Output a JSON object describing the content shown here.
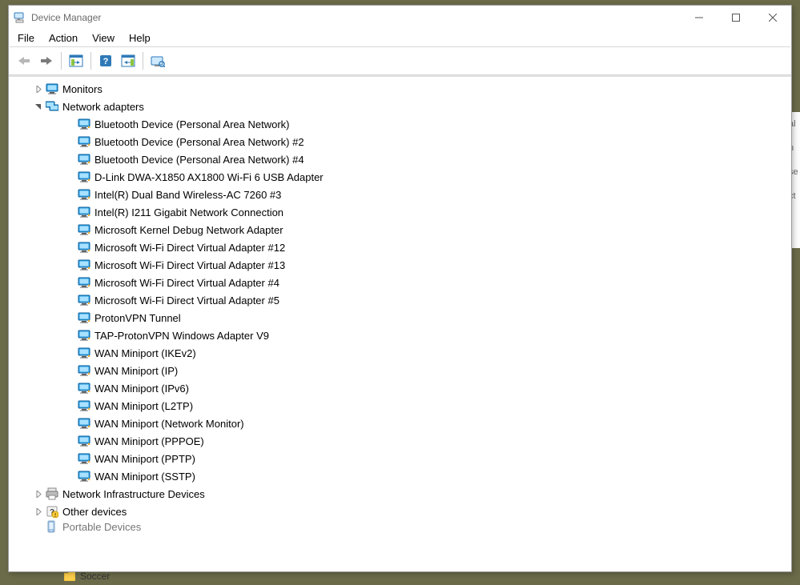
{
  "window": {
    "title": "Device Manager"
  },
  "menu": {
    "file": "File",
    "action": "Action",
    "view": "View",
    "help": "Help"
  },
  "tree": [
    {
      "level": 1,
      "expand": "collapsed",
      "icon": "monitor",
      "label": "Monitors"
    },
    {
      "level": 1,
      "expand": "expanded",
      "icon": "netcat",
      "label": "Network adapters"
    },
    {
      "level": 2,
      "expand": "none",
      "icon": "net",
      "label": "Bluetooth Device (Personal Area Network)"
    },
    {
      "level": 2,
      "expand": "none",
      "icon": "net",
      "label": "Bluetooth Device (Personal Area Network) #2"
    },
    {
      "level": 2,
      "expand": "none",
      "icon": "net",
      "label": "Bluetooth Device (Personal Area Network) #4"
    },
    {
      "level": 2,
      "expand": "none",
      "icon": "net",
      "label": "D-Link DWA-X1850 AX1800 Wi-Fi 6 USB Adapter"
    },
    {
      "level": 2,
      "expand": "none",
      "icon": "net",
      "label": "Intel(R) Dual Band Wireless-AC 7260 #3"
    },
    {
      "level": 2,
      "expand": "none",
      "icon": "net",
      "label": "Intel(R) I211 Gigabit Network Connection"
    },
    {
      "level": 2,
      "expand": "none",
      "icon": "net",
      "label": "Microsoft Kernel Debug Network Adapter"
    },
    {
      "level": 2,
      "expand": "none",
      "icon": "net",
      "label": "Microsoft Wi-Fi Direct Virtual Adapter #12"
    },
    {
      "level": 2,
      "expand": "none",
      "icon": "net",
      "label": "Microsoft Wi-Fi Direct Virtual Adapter #13"
    },
    {
      "level": 2,
      "expand": "none",
      "icon": "net",
      "label": "Microsoft Wi-Fi Direct Virtual Adapter #4"
    },
    {
      "level": 2,
      "expand": "none",
      "icon": "net",
      "label": "Microsoft Wi-Fi Direct Virtual Adapter #5"
    },
    {
      "level": 2,
      "expand": "none",
      "icon": "net",
      "label": "ProtonVPN Tunnel"
    },
    {
      "level": 2,
      "expand": "none",
      "icon": "net",
      "label": "TAP-ProtonVPN Windows Adapter V9"
    },
    {
      "level": 2,
      "expand": "none",
      "icon": "net",
      "label": "WAN Miniport (IKEv2)"
    },
    {
      "level": 2,
      "expand": "none",
      "icon": "net",
      "label": "WAN Miniport (IP)"
    },
    {
      "level": 2,
      "expand": "none",
      "icon": "net",
      "label": "WAN Miniport (IPv6)"
    },
    {
      "level": 2,
      "expand": "none",
      "icon": "net",
      "label": "WAN Miniport (L2TP)"
    },
    {
      "level": 2,
      "expand": "none",
      "icon": "net",
      "label": "WAN Miniport (Network Monitor)"
    },
    {
      "level": 2,
      "expand": "none",
      "icon": "net",
      "label": "WAN Miniport (PPPOE)"
    },
    {
      "level": 2,
      "expand": "none",
      "icon": "net",
      "label": "WAN Miniport (PPTP)"
    },
    {
      "level": 2,
      "expand": "none",
      "icon": "net",
      "label": "WAN Miniport (SSTP)"
    },
    {
      "level": 1,
      "expand": "collapsed",
      "icon": "printer",
      "label": "Network Infrastructure Devices"
    },
    {
      "level": 1,
      "expand": "collapsed",
      "icon": "other",
      "label": "Other devices"
    },
    {
      "level": 1,
      "expand": "none",
      "icon": "portable",
      "label": "Portable Devices",
      "cutoff": true
    }
  ],
  "bg": {
    "folder": "Soccer"
  }
}
